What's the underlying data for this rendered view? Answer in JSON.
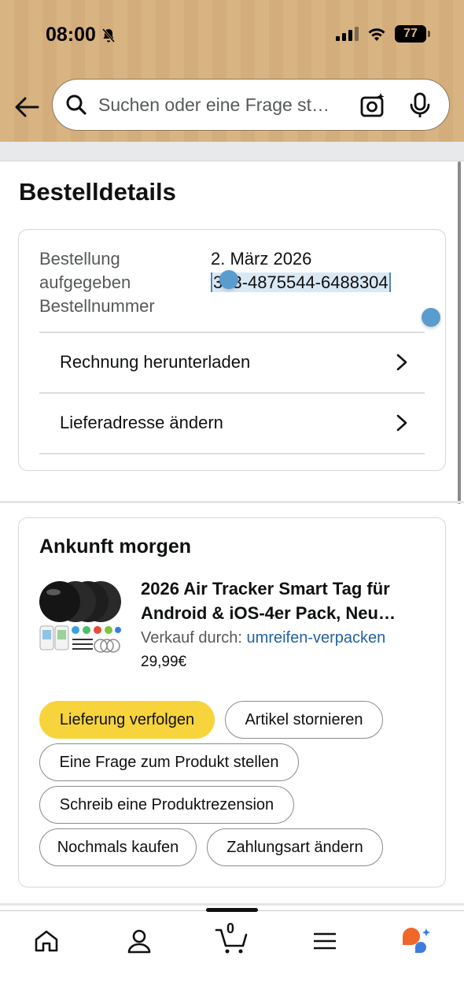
{
  "status_bar": {
    "time": "08:00",
    "battery": "77"
  },
  "search": {
    "placeholder": "Suchen oder eine Frage st…"
  },
  "page": {
    "title": "Bestelldetails"
  },
  "order": {
    "label_date": "Bestellung aufgegeben",
    "label_number": "Bestellnummer",
    "date": "2. März 2026",
    "number": "303-4875544-6488304",
    "actions": [
      "Rechnung herunterladen",
      "Lieferadresse ändern"
    ]
  },
  "shipment": {
    "status": "Ankunft morgen",
    "product_title": "2026 Air Tracker Smart Tag für Android & iOS-4er Pack, Neu…",
    "seller_prefix": "Verkauf durch: ",
    "seller_name": "umreifen-verpacken",
    "price": "29,99€",
    "buttons": {
      "track": "Lieferung verfolgen",
      "cancel": "Artikel stornieren",
      "question": "Eine Frage zum Produkt stellen",
      "review": "Schreib eine Produktrezension",
      "rebuy": "Nochmals kaufen",
      "payment": "Zahlungsart ändern"
    }
  },
  "tabbar": {
    "cart_count": "0",
    "icons": [
      "home-icon",
      "account-icon",
      "cart-icon",
      "menu-icon",
      "ai-assistant-icon"
    ]
  },
  "colors": {
    "header": "#d9b483",
    "primary_button": "#f7d33c",
    "link": "#2162a1",
    "selection": "#5b9ccf"
  }
}
